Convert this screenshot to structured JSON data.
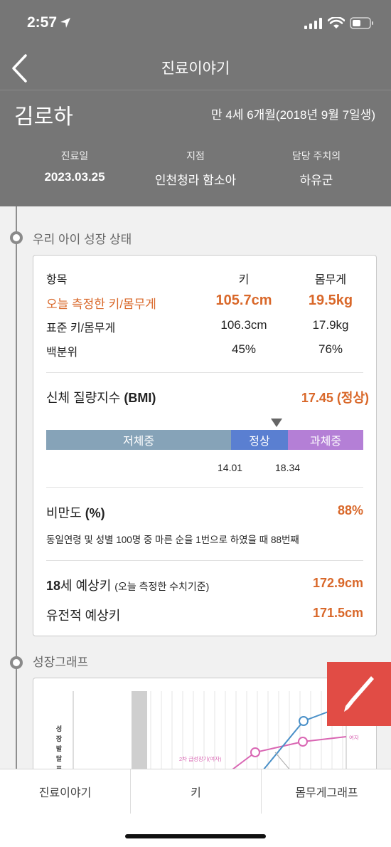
{
  "status": {
    "time": "2:57"
  },
  "nav": {
    "title": "진료이야기"
  },
  "patient": {
    "name": "김로하",
    "age": "만 4세 6개월(2018년 9월 7일생)",
    "visit_date_label": "진료일",
    "visit_date": "2023.03.25",
    "branch_label": "지점",
    "branch": "인천청라 함소아",
    "doctor_label": "담당 주치의",
    "doctor": "하유군"
  },
  "growth_status": {
    "section_title": "우리 아이 성장 상태",
    "table": {
      "header": {
        "item": "항목",
        "height": "키",
        "weight": "몸무게"
      },
      "today": {
        "label": "오늘 측정한 키/몸무게",
        "height": "105.7cm",
        "weight": "19.5kg"
      },
      "standard": {
        "label": "표준 키/몸무게",
        "height": "106.3cm",
        "weight": "17.9kg"
      },
      "percentile": {
        "label": "백분위",
        "height": "45%",
        "weight": "76%"
      }
    },
    "bmi": {
      "label_prefix": "신체 질량지수 ",
      "label_bold": "(BMI)",
      "value": "17.45 (정상)",
      "segments": {
        "under": "저체중",
        "normal": "정상",
        "over": "과체중"
      },
      "tick_low": "14.01",
      "tick_high": "18.34",
      "colors": {
        "under": "#86a3b8",
        "normal": "#5a7fd1",
        "over": "#b47fd6"
      }
    },
    "obesity": {
      "label_prefix": "비만도 ",
      "label_bold": "(%)",
      "value": "88%",
      "description": "동일연령 및 성별 100명 중 마른 순을 1번으로 하였을 때 88번째"
    },
    "prediction_18": {
      "label_bold": "18",
      "label": "세 예상키 ",
      "note": "(오늘 측정한 수치기준)",
      "value": "172.9cm"
    },
    "prediction_genetic": {
      "label": "유전적 예상키",
      "value": "171.5cm"
    }
  },
  "growth_graph": {
    "section_title": "성장그래프",
    "y_label": [
      "성",
      "장",
      "발",
      "달",
      "표"
    ],
    "annotation_girl": "2차 급성장기(여자)",
    "legend_girl": "여자"
  },
  "tabs": [
    "진료이야기",
    "키",
    "몸무게그래프"
  ],
  "accent_color": "#d9682a"
}
